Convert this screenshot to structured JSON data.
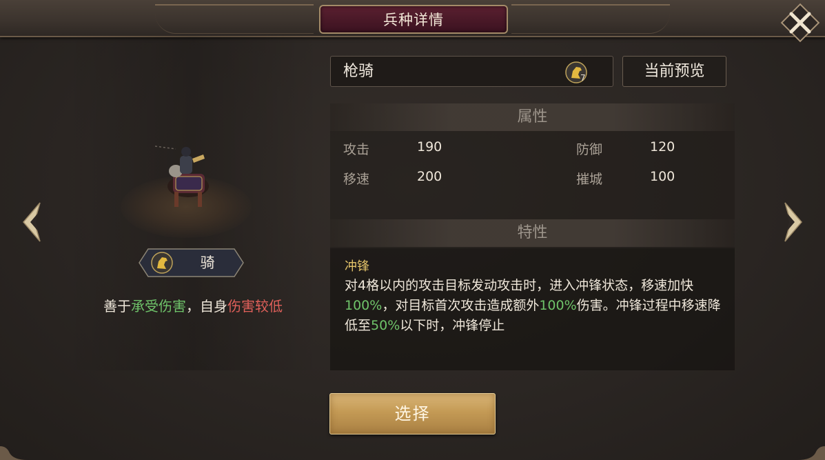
{
  "window": {
    "title": "兵种详情",
    "close_icon": "close-x-icon"
  },
  "unit": {
    "type_label": "骑",
    "description_parts": [
      "善于",
      "承受伤害",
      "，自身",
      "伤害较低"
    ],
    "name": "枪骑",
    "level": "7"
  },
  "buttons": {
    "preview": "当前预览",
    "select": "选择"
  },
  "attributes": {
    "header": "属性",
    "items": [
      {
        "label": "攻击",
        "value": "190"
      },
      {
        "label": "防御",
        "value": "120"
      },
      {
        "label": "移速",
        "value": "200"
      },
      {
        "label": "摧城",
        "value": "100"
      }
    ]
  },
  "traits": {
    "header": "特性",
    "title": "冲锋",
    "text_parts": [
      "对4格以内的攻击目标发动攻击时，进入冲锋状态，移速加快",
      "100%",
      "，对目标首次攻击造成额外",
      "100%",
      "伤害。冲锋过程中移速降低至",
      "50%",
      "以下时，冲锋停止"
    ]
  },
  "colors": {
    "accent_gold": "#e4c46a",
    "positive": "#6fc46a",
    "negative": "#e0605a"
  }
}
